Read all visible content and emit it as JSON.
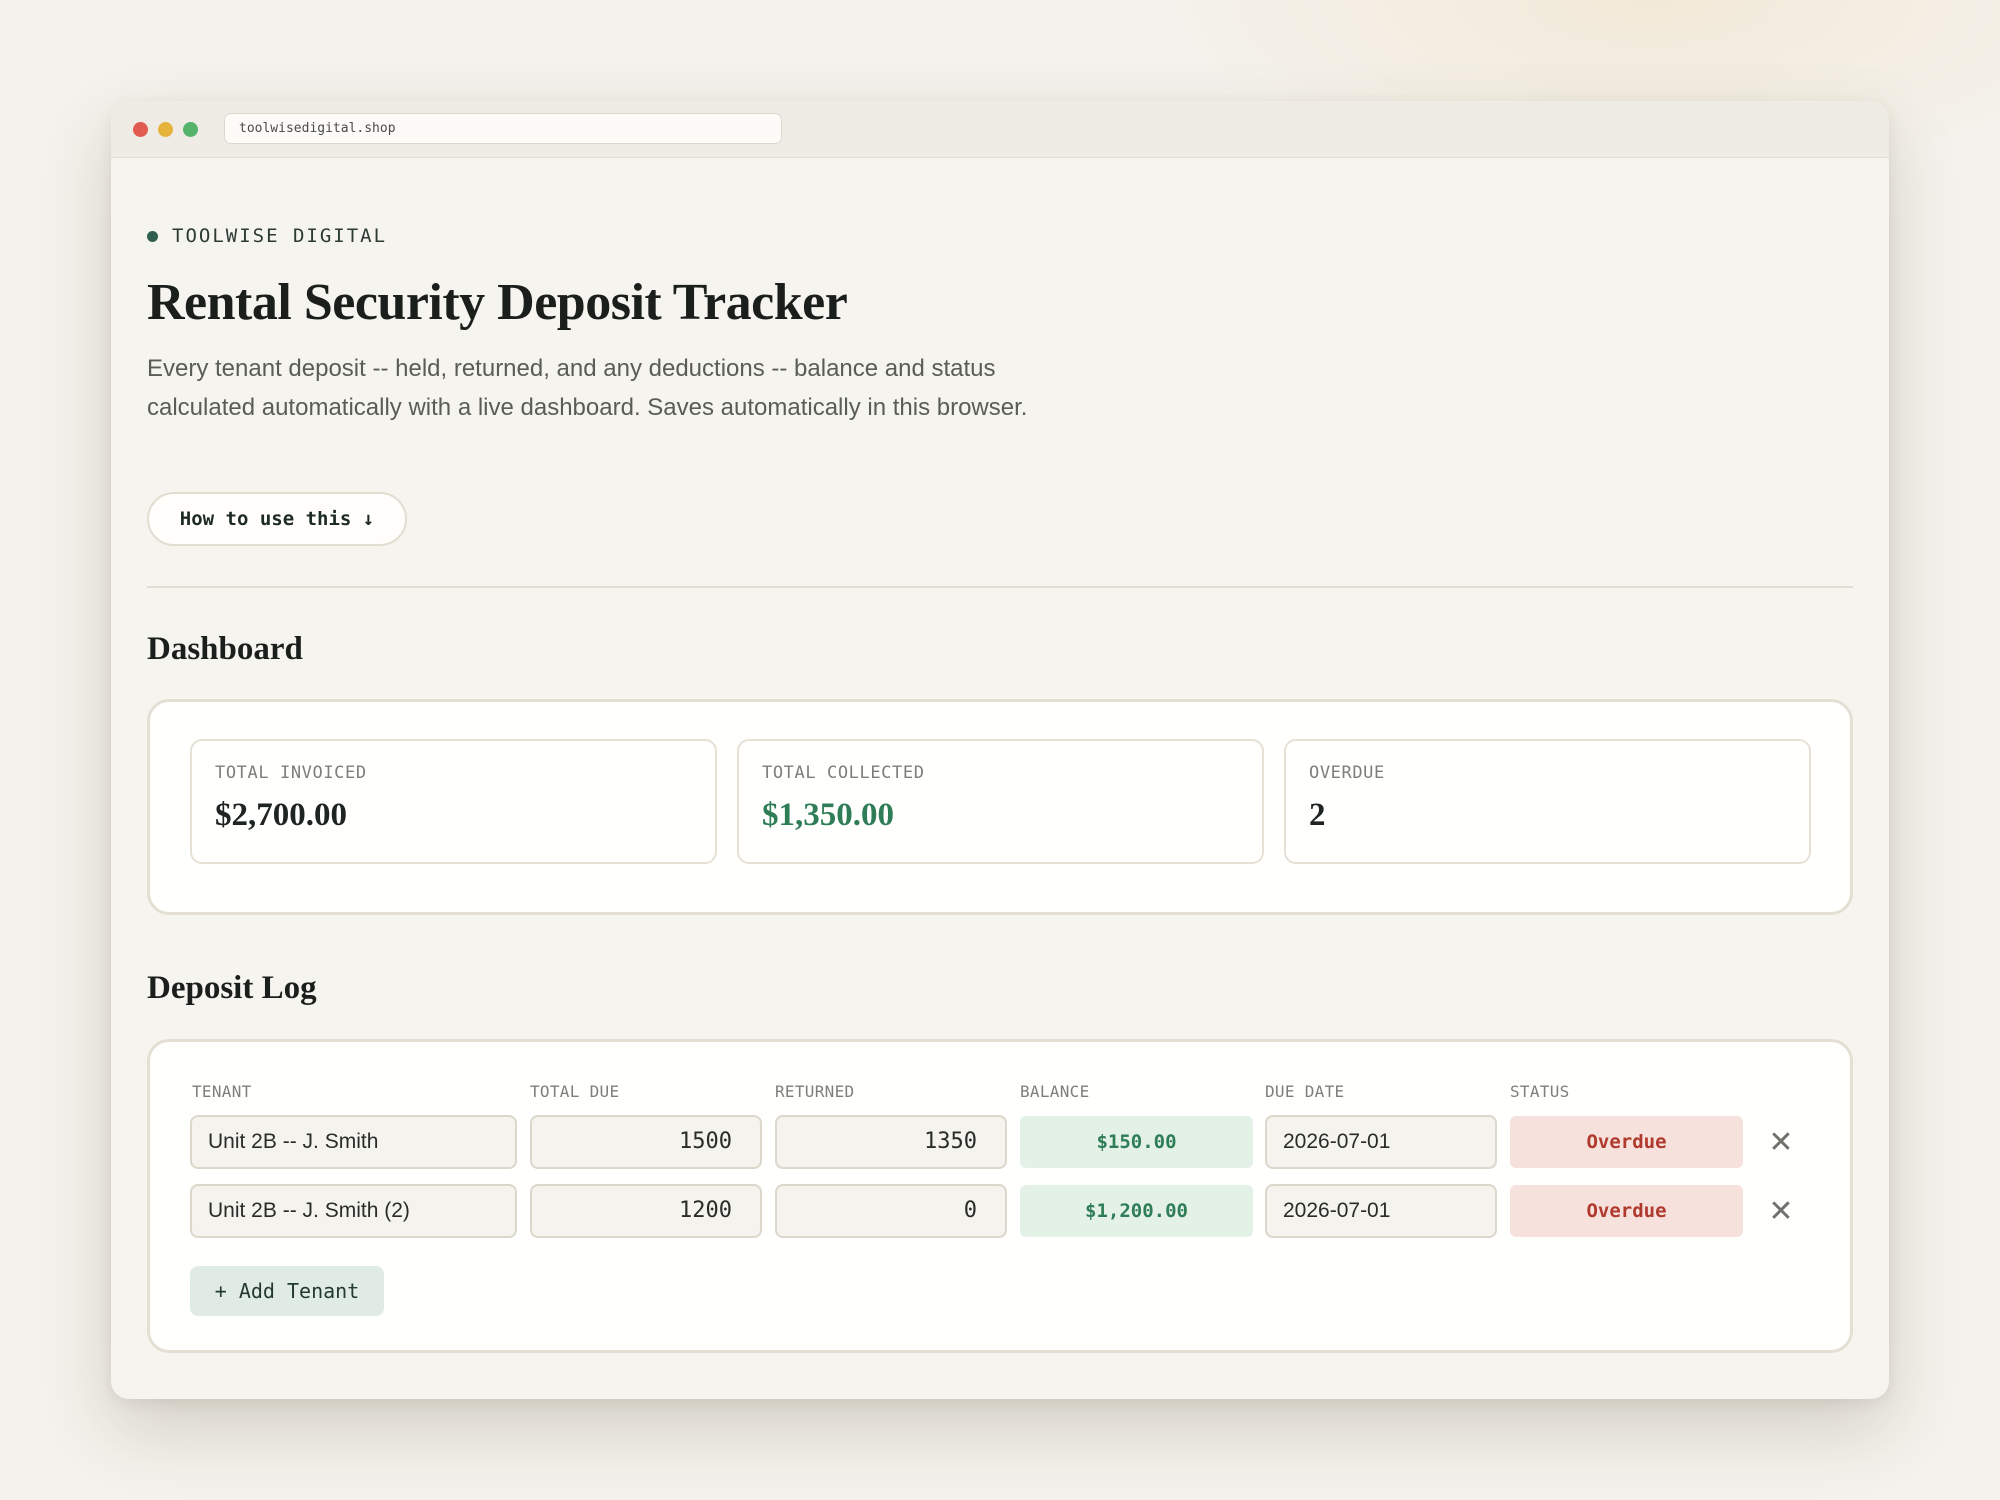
{
  "browser": {
    "url": "toolwisedigital.shop"
  },
  "header": {
    "brand": "TOOLWISE DIGITAL",
    "title": "Rental Security Deposit Tracker",
    "description": "Every tenant deposit -- held, returned, and any deductions -- balance and status calculated automatically with a live dashboard. Saves automatically in this browser.",
    "howto_label": "How to use this ↓"
  },
  "dashboard": {
    "heading": "Dashboard",
    "stats": [
      {
        "label": "TOTAL INVOICED",
        "value": "$2,700.00"
      },
      {
        "label": "TOTAL COLLECTED",
        "value": "$1,350.00"
      },
      {
        "label": "OVERDUE",
        "value": "2"
      }
    ]
  },
  "log": {
    "heading": "Deposit Log",
    "columns": [
      "TENANT",
      "TOTAL DUE",
      "RETURNED",
      "BALANCE",
      "DUE DATE",
      "STATUS"
    ],
    "rows": [
      {
        "tenant": "Unit 2B -- J. Smith",
        "total_due": "1500",
        "returned": "1350",
        "balance": "$150.00",
        "due_date": "2026-07-01",
        "status": "Overdue"
      },
      {
        "tenant": "Unit 2B -- J. Smith (2)",
        "total_due": "1200",
        "returned": "0",
        "balance": "$1,200.00",
        "due_date": "2026-07-01",
        "status": "Overdue"
      }
    ],
    "delete_glyph": "✕",
    "add_label": "+ Add Tenant"
  },
  "colors": {
    "accent_green": "#2e7d57",
    "overdue_red": "#b03a2e",
    "background": "#f4f2ec"
  }
}
